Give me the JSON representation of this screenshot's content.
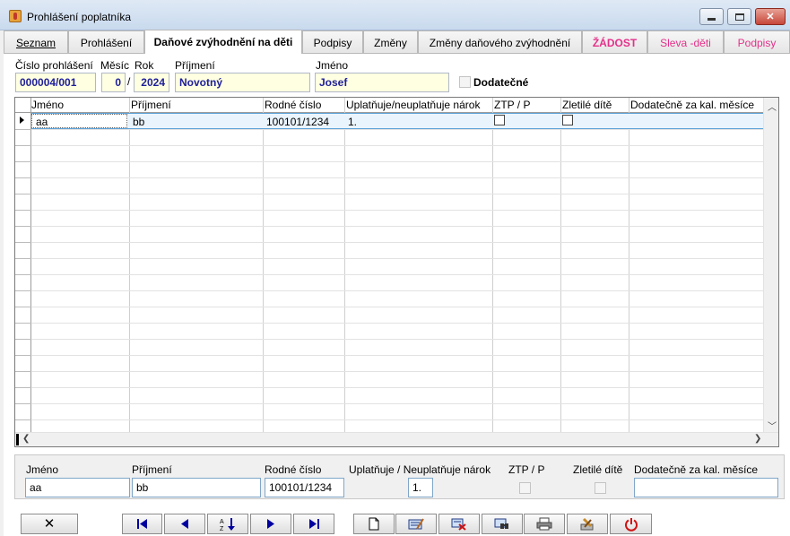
{
  "window": {
    "title": "Prohlášení poplatníka",
    "minimize_glyph": "minimize-icon",
    "maximize_glyph": "maximize-icon",
    "close_glyph": "✕"
  },
  "tabs": [
    {
      "label": "Seznam"
    },
    {
      "label": "Prohlášení"
    },
    {
      "label": "Daňové zvýhodnění na děti"
    },
    {
      "label": "Podpisy"
    },
    {
      "label": "Změny"
    },
    {
      "label": "Změny daňového zvýhodnění"
    },
    {
      "label": "ŽÁDOST"
    },
    {
      "label": "Sleva -děti"
    },
    {
      "label": "Podpisy"
    }
  ],
  "header": {
    "cislo_label": "Číslo prohlášení",
    "cislo_value": "000004/001",
    "mesic_label": "Měsíc",
    "mesic_value": "0",
    "separator": "/",
    "rok_label": "Rok",
    "rok_value": "2024",
    "prijmeni_label": "Příjmení",
    "prijmeni_value": "Novotný",
    "jmeno_label": "Jméno",
    "jmeno_value": "Josef",
    "dodatecne_label": "Dodatečné"
  },
  "grid": {
    "columns": [
      "Jméno",
      "Příjmení",
      "Rodné číslo",
      "Uplatňuje/neuplatňuje nárok",
      "ZTP / P",
      "Zletilé dítě",
      "Dodatečně za kal. měsíce"
    ],
    "rows": [
      {
        "jmeno": "aa",
        "prijmeni": "bb",
        "rodne_cislo": "100101/1234",
        "uplatnuje": "1.",
        "ztp": false,
        "zletile": false,
        "dodatecne": ""
      }
    ]
  },
  "detail": {
    "jmeno_label": "Jméno",
    "jmeno_value": "aa",
    "prijmeni_label": "Příjmení",
    "prijmeni_value": "bb",
    "rodne_label": "Rodné číslo",
    "rodne_value": "100101/1234",
    "uplatnuje_label": "Uplatňuje / Neuplatňuje nárok",
    "uplatnuje_value": "1.",
    "ztp_label": "ZTP / P",
    "zletile_label": "Zletilé dítě",
    "dodatecne_label": "Dodatečně za kal. měsíce",
    "dodatecne_value": ""
  },
  "toolbar": {
    "close_icon": "close-icon",
    "first_icon": "first-record-icon",
    "prev_icon": "previous-record-icon",
    "sort_icon": "sort-az-icon",
    "next_icon": "next-record-icon",
    "last_icon": "last-record-icon",
    "new_icon": "new-document-icon",
    "edit_icon": "edit-record-icon",
    "delete_icon": "delete-record-icon",
    "find_icon": "find-icon",
    "print_icon": "printer-icon",
    "tools_icon": "tools-icon",
    "power_icon": "power-icon"
  },
  "colors": {
    "field_bg": "#ffffe1",
    "field_text": "#20209a",
    "tab_pink": "#e4318a",
    "selection": "#eaf4fc"
  }
}
